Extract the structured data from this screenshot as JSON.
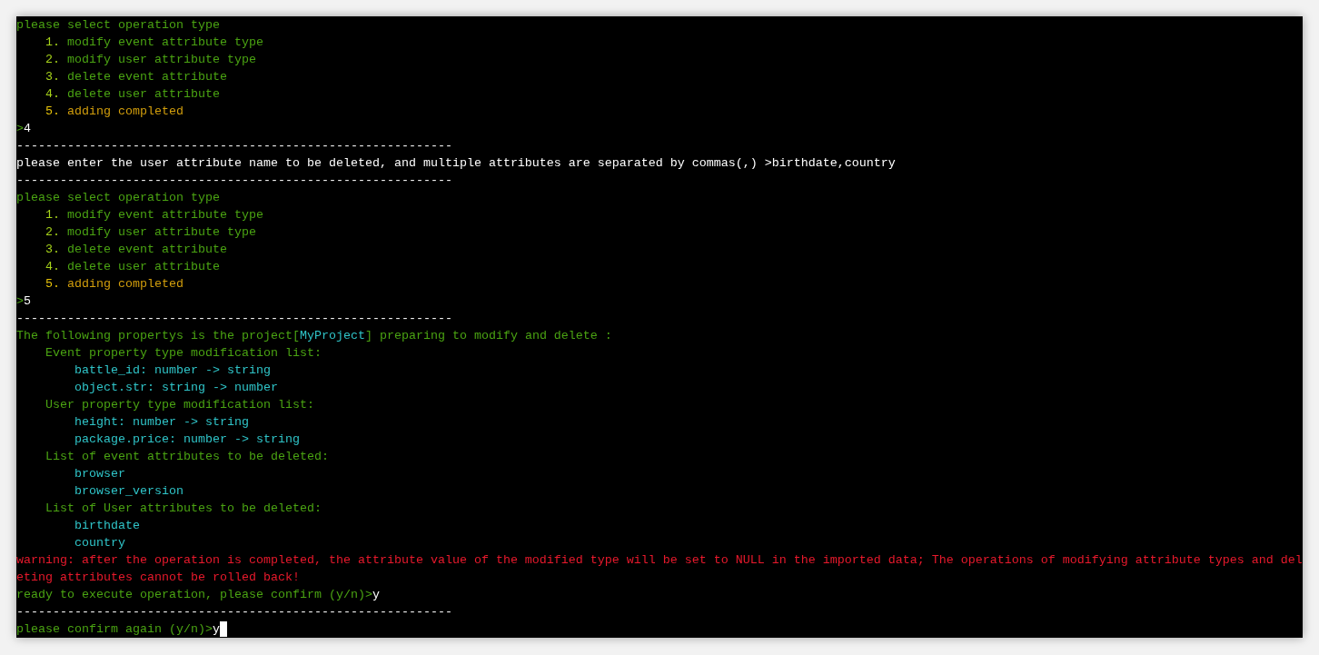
{
  "terminal": {
    "lines": [
      {
        "kind": "plain",
        "segments": [
          {
            "kind": "prompt",
            "text": "please select operation type"
          }
        ]
      },
      {
        "kind": "option",
        "segments": [
          {
            "kind": "number",
            "text": "1."
          },
          {
            "kind": "prompt",
            "text": " modify event attribute type"
          }
        ]
      },
      {
        "kind": "option",
        "segments": [
          {
            "kind": "number",
            "text": "2."
          },
          {
            "kind": "prompt",
            "text": " modify user attribute type"
          }
        ]
      },
      {
        "kind": "option",
        "segments": [
          {
            "kind": "number",
            "text": "3."
          },
          {
            "kind": "prompt",
            "text": " delete event attribute"
          }
        ]
      },
      {
        "kind": "option",
        "segments": [
          {
            "kind": "number",
            "text": "4."
          },
          {
            "kind": "prompt",
            "text": " delete user attribute"
          }
        ]
      },
      {
        "kind": "option",
        "segments": [
          {
            "kind": "finish_number",
            "text": "5."
          },
          {
            "kind": "finish",
            "text": " adding completed"
          }
        ]
      },
      {
        "kind": "plain",
        "segments": [
          {
            "kind": "prompt",
            "text": ">"
          },
          {
            "kind": "input",
            "text": "4"
          }
        ]
      },
      {
        "kind": "plain",
        "segments": [
          {
            "kind": "input",
            "text": "------------------------------------------------------------"
          }
        ]
      },
      {
        "kind": "plain",
        "segments": [
          {
            "kind": "input",
            "text": "please enter the user attribute name to be deleted, and multiple attributes are separated by commas(,) >birthdate,country"
          }
        ]
      },
      {
        "kind": "plain",
        "segments": [
          {
            "kind": "input",
            "text": "------------------------------------------------------------"
          }
        ]
      },
      {
        "kind": "plain",
        "segments": [
          {
            "kind": "prompt",
            "text": "please select operation type"
          }
        ]
      },
      {
        "kind": "option",
        "segments": [
          {
            "kind": "number",
            "text": "1."
          },
          {
            "kind": "prompt",
            "text": " modify event attribute type"
          }
        ]
      },
      {
        "kind": "option",
        "segments": [
          {
            "kind": "number",
            "text": "2."
          },
          {
            "kind": "prompt",
            "text": " modify user attribute type"
          }
        ]
      },
      {
        "kind": "option",
        "segments": [
          {
            "kind": "number",
            "text": "3."
          },
          {
            "kind": "prompt",
            "text": " delete event attribute"
          }
        ]
      },
      {
        "kind": "option",
        "segments": [
          {
            "kind": "number",
            "text": "4."
          },
          {
            "kind": "prompt",
            "text": " delete user attribute"
          }
        ]
      },
      {
        "kind": "option",
        "segments": [
          {
            "kind": "finish_number",
            "text": "5."
          },
          {
            "kind": "finish",
            "text": " adding completed"
          }
        ]
      },
      {
        "kind": "plain",
        "segments": [
          {
            "kind": "prompt",
            "text": ">"
          },
          {
            "kind": "input",
            "text": "5"
          }
        ]
      },
      {
        "kind": "plain",
        "segments": [
          {
            "kind": "input",
            "text": "------------------------------------------------------------"
          }
        ]
      },
      {
        "kind": "plain",
        "segments": [
          {
            "kind": "prompt",
            "text": "The following propertys is the project["
          },
          {
            "kind": "value",
            "text": "MyProject"
          },
          {
            "kind": "prompt",
            "text": "] preparing to modify and delete :"
          }
        ]
      },
      {
        "kind": "header",
        "segments": [
          {
            "kind": "prompt",
            "text": "Event property type modification list:"
          }
        ]
      },
      {
        "kind": "item",
        "segments": [
          {
            "kind": "value",
            "text": "battle_id: number -> string"
          }
        ]
      },
      {
        "kind": "item",
        "segments": [
          {
            "kind": "value",
            "text": "object.str: string -> number"
          }
        ]
      },
      {
        "kind": "header",
        "segments": [
          {
            "kind": "prompt",
            "text": "User property type modification list:"
          }
        ]
      },
      {
        "kind": "item",
        "segments": [
          {
            "kind": "value",
            "text": "height: number -> string"
          }
        ]
      },
      {
        "kind": "item",
        "segments": [
          {
            "kind": "value",
            "text": "package.price: number -> string"
          }
        ]
      },
      {
        "kind": "header",
        "segments": [
          {
            "kind": "prompt",
            "text": "List of event attributes to be deleted:"
          }
        ]
      },
      {
        "kind": "item",
        "segments": [
          {
            "kind": "value",
            "text": "browser"
          }
        ]
      },
      {
        "kind": "item",
        "segments": [
          {
            "kind": "value",
            "text": "browser_version"
          }
        ]
      },
      {
        "kind": "header",
        "segments": [
          {
            "kind": "prompt",
            "text": "List of User attributes to be deleted:"
          }
        ]
      },
      {
        "kind": "item",
        "segments": [
          {
            "kind": "value",
            "text": "birthdate"
          }
        ]
      },
      {
        "kind": "item",
        "segments": [
          {
            "kind": "value",
            "text": "country"
          }
        ]
      },
      {
        "kind": "plain",
        "segments": [
          {
            "kind": "warning",
            "text": "warning: after the operation is completed, the attribute value of the modified type will be set to NULL in the imported data; The operations of modifying attribute types and del"
          }
        ]
      },
      {
        "kind": "plain",
        "segments": [
          {
            "kind": "warning",
            "text": "eting attributes cannot be rolled back!"
          }
        ]
      },
      {
        "kind": "plain",
        "segments": [
          {
            "kind": "prompt",
            "text": "ready to execute operation, please confirm (y/n)>"
          },
          {
            "kind": "input",
            "text": "y"
          }
        ]
      },
      {
        "kind": "plain",
        "segments": [
          {
            "kind": "input",
            "text": "------------------------------------------------------------"
          }
        ]
      },
      {
        "kind": "plain",
        "segments": [
          {
            "kind": "prompt",
            "text": "please confirm again (y/n)>"
          },
          {
            "kind": "input",
            "text": "y"
          }
        ],
        "cursor": true
      }
    ]
  }
}
